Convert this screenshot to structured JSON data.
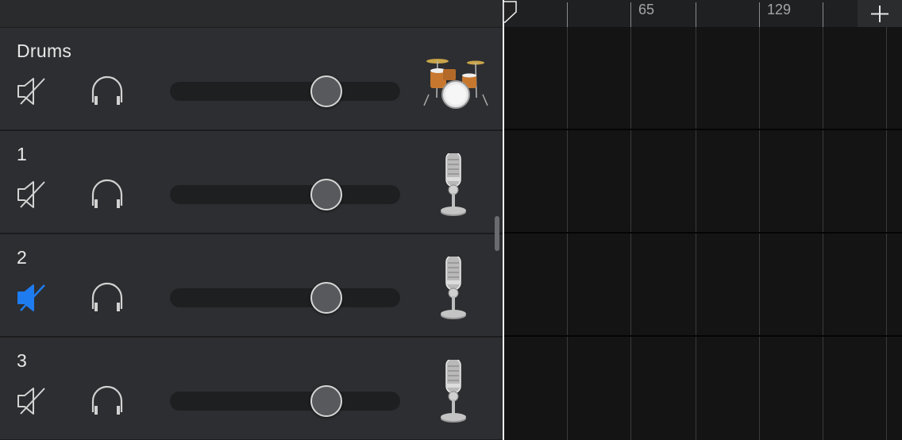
{
  "tracks": [
    {
      "name": "Drums",
      "muted": false,
      "volume": 0.68,
      "instrument": "drum-kit-icon"
    },
    {
      "name": "1",
      "muted": false,
      "volume": 0.68,
      "instrument": "microphone-icon"
    },
    {
      "name": "2",
      "muted": true,
      "volume": 0.68,
      "instrument": "microphone-icon"
    },
    {
      "name": "3",
      "muted": false,
      "volume": 0.68,
      "instrument": "microphone-icon"
    }
  ],
  "ruler": {
    "labels": [
      "65",
      "129"
    ]
  },
  "icons": {
    "mute": "speaker-muted-icon",
    "solo": "headphones-icon",
    "add": "plus-icon"
  },
  "colors": {
    "mute_active": "#1e7cf0",
    "icon_default": "#d2d2d2"
  }
}
